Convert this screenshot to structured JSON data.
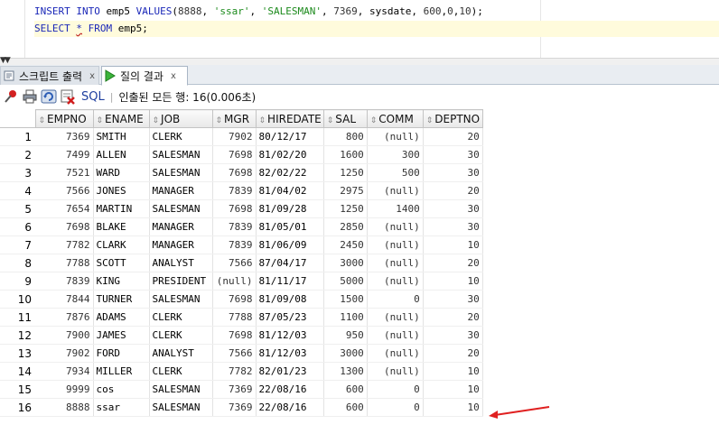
{
  "editor": {
    "line1": {
      "insert": "INSERT",
      "into": "INTO",
      "table": "emp5",
      "values": "VALUES",
      "args": [
        "8888",
        "'ssar'",
        "'SALESMAN'",
        "7369",
        "sysdate",
        "600",
        "0",
        "10"
      ]
    },
    "line2": {
      "select": "SELECT",
      "star": "*",
      "from": "FROM",
      "table": "emp5"
    }
  },
  "tabs": [
    {
      "label": "스크립트 출력",
      "close": "x"
    },
    {
      "label": "질의 결과",
      "close": "x"
    }
  ],
  "toolbar": {
    "sql_label": "SQL",
    "separator": "|",
    "fetch_status": "인출된 모든 행: 16(0.006초)"
  },
  "grid": {
    "columns": [
      "EMPNO",
      "ENAME",
      "JOB",
      "MGR",
      "HIREDATE",
      "SAL",
      "COMM",
      "DEPTNO"
    ],
    "rows": [
      [
        "1",
        "7369",
        "SMITH",
        "CLERK",
        "7902",
        "80/12/17",
        "800",
        "(null)",
        "20"
      ],
      [
        "2",
        "7499",
        "ALLEN",
        "SALESMAN",
        "7698",
        "81/02/20",
        "1600",
        "300",
        "30"
      ],
      [
        "3",
        "7521",
        "WARD",
        "SALESMAN",
        "7698",
        "82/02/22",
        "1250",
        "500",
        "30"
      ],
      [
        "4",
        "7566",
        "JONES",
        "MANAGER",
        "7839",
        "81/04/02",
        "2975",
        "(null)",
        "20"
      ],
      [
        "5",
        "7654",
        "MARTIN",
        "SALESMAN",
        "7698",
        "81/09/28",
        "1250",
        "1400",
        "30"
      ],
      [
        "6",
        "7698",
        "BLAKE",
        "MANAGER",
        "7839",
        "81/05/01",
        "2850",
        "(null)",
        "30"
      ],
      [
        "7",
        "7782",
        "CLARK",
        "MANAGER",
        "7839",
        "81/06/09",
        "2450",
        "(null)",
        "10"
      ],
      [
        "8",
        "7788",
        "SCOTT",
        "ANALYST",
        "7566",
        "87/04/17",
        "3000",
        "(null)",
        "20"
      ],
      [
        "9",
        "7839",
        "KING",
        "PRESIDENT",
        "(null)",
        "81/11/17",
        "5000",
        "(null)",
        "10"
      ],
      [
        "10",
        "7844",
        "TURNER",
        "SALESMAN",
        "7698",
        "81/09/08",
        "1500",
        "0",
        "30"
      ],
      [
        "11",
        "7876",
        "ADAMS",
        "CLERK",
        "7788",
        "87/05/23",
        "1100",
        "(null)",
        "20"
      ],
      [
        "12",
        "7900",
        "JAMES",
        "CLERK",
        "7698",
        "81/12/03",
        "950",
        "(null)",
        "30"
      ],
      [
        "13",
        "7902",
        "FORD",
        "ANALYST",
        "7566",
        "81/12/03",
        "3000",
        "(null)",
        "20"
      ],
      [
        "14",
        "7934",
        "MILLER",
        "CLERK",
        "7782",
        "82/01/23",
        "1300",
        "(null)",
        "10"
      ],
      [
        "15",
        "9999",
        "cos",
        "SALESMAN",
        "7369",
        "22/08/16",
        "600",
        "0",
        "10"
      ],
      [
        "16",
        "8888",
        "ssar",
        "SALESMAN",
        "7369",
        "22/08/16",
        "600",
        "0",
        "10"
      ]
    ]
  },
  "icons": {
    "pin": "pin-icon",
    "print": "print-icon",
    "refresh": "refresh-icon",
    "export": "export-icon",
    "sort": "sort-arrows-icon",
    "run": "run-icon",
    "script": "script-output-icon",
    "annotation": "red-arrow-icon"
  },
  "colors": {
    "keyword": "#1a27b8",
    "string": "#1c8a1c",
    "highlight_line": "#fffbdc",
    "annotation": "#e02020"
  }
}
